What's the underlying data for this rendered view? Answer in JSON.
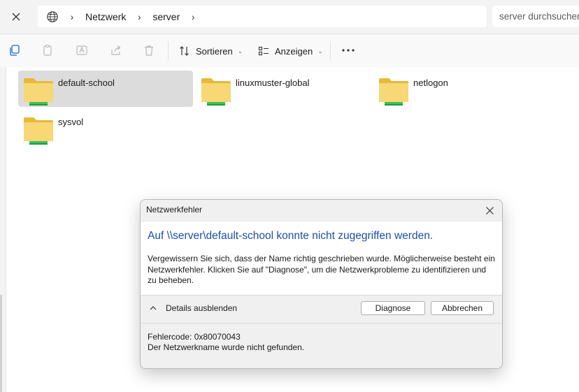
{
  "breadcrumb": {
    "items": [
      "Netzwerk",
      "server"
    ]
  },
  "search": {
    "placeholder": "server durchsuchen"
  },
  "toolbar": {
    "sort_label": "Sortieren",
    "view_label": "Anzeigen"
  },
  "folders": [
    {
      "name": "default-school",
      "selected": true
    },
    {
      "name": "linuxmuster-global",
      "selected": false
    },
    {
      "name": "netlogon",
      "selected": false
    },
    {
      "name": "sysvol",
      "selected": false
    }
  ],
  "dialog": {
    "title": "Netzwerkfehler",
    "heading": "Auf \\\\server\\default-school konnte nicht zugegriffen werden.",
    "message": "Vergewissern Sie sich, dass der Name richtig geschrieben wurde. Möglicherweise besteht ein Netzwerkfehler. Klicken Sie auf \"Diagnose\", um die Netzwerkprobleme zu identifizieren und zu beheben.",
    "details_toggle": "Details ausblenden",
    "diagnose_button": "Diagnose",
    "cancel_button": "Abbrechen",
    "error_code": "Fehlercode: 0x80070043",
    "error_text": "Der Netzwerkname wurde nicht gefunden."
  },
  "colors": {
    "accent_heading": "#1b4fa2",
    "selection": "#dcdcdc",
    "folder_yellow": "#f8d775",
    "share_green": "#3cc15a"
  }
}
